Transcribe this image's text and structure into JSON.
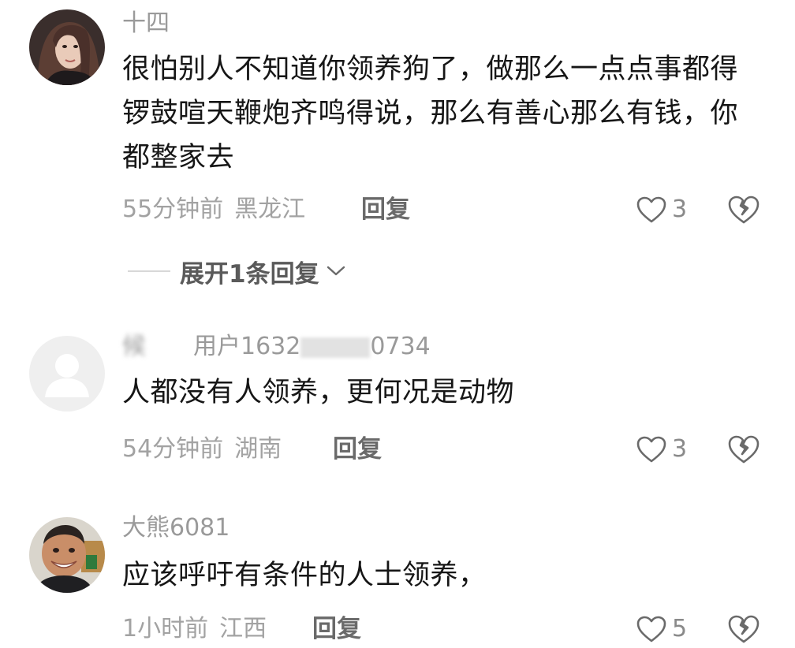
{
  "comments": [
    {
      "username": "十四",
      "text": "很怕别人不知道你领养狗了，做那么一点点事都得锣鼓喧天鞭炮齐鸣得说，那么有善心那么有钱，你都整家去",
      "time": "55分钟前",
      "location": "黑龙江",
      "reply_label": "回复",
      "likes": "3",
      "expand_label": "展开1条回复"
    },
    {
      "username_parts": [
        "候",
        "",
        "用户1632",
        "",
        "0734"
      ],
      "text": "人都没有人领养，更何况是动物",
      "time": "54分钟前",
      "location": "湖南",
      "reply_label": "回复",
      "likes": "3"
    },
    {
      "username": "大熊6081",
      "text": "应该呼吁有条件的人士领养，",
      "time": "1小时前",
      "location": "江西",
      "reply_label": "回复",
      "likes": "5"
    }
  ],
  "icons": {
    "like": "heart-outline-icon",
    "dislike": "broken-heart-icon",
    "expand": "chevron-down-icon"
  },
  "colors": {
    "meta": "#a2a2a2",
    "username": "#9a9a9a",
    "text": "#161616"
  }
}
